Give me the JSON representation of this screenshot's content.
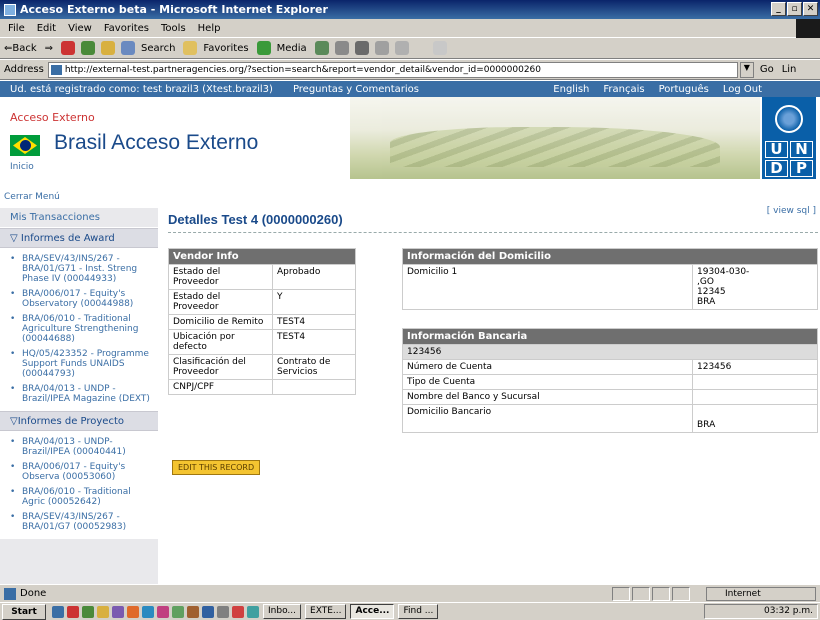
{
  "window": {
    "title": "Acceso Externo beta - Microsoft Internet Explorer"
  },
  "menu": [
    "File",
    "Edit",
    "View",
    "Favorites",
    "Tools",
    "Help"
  ],
  "toolbar": {
    "back": "⇐Back",
    "search": "Search",
    "favorites": "Favorites",
    "media": "Media"
  },
  "address": {
    "label": "Address",
    "url": "http://external-test.partneragencies.org/?section=search&report=vendor_detail&vendor_id=0000000260",
    "go": "Go",
    "links": "Lin"
  },
  "topnav": {
    "user": "Ud. está registrado como: test brazil3 (Xtest.brazil3)",
    "preguntas": "Preguntas y Comentarios",
    "langs": [
      "English",
      "Français",
      "Português",
      "Log Out"
    ]
  },
  "banner": {
    "acceso": "Acceso Externo",
    "title": "Brasil Acceso Externo",
    "inicio": "Inicio",
    "undp": [
      "U",
      "N",
      "D",
      "P"
    ]
  },
  "sidebar": {
    "cerrar": "Cerrar Menú",
    "transacciones": "Mis Transacciones",
    "award_title": "Informes de Award",
    "award_items": [
      "BRA/SEV/43/INS/267 - BRA/01/G71 - Inst. Streng Phase IV (00044933)",
      "BRA/006/017 - Equity's Observatory (00044988)",
      "BRA/06/010 - Traditional Agriculture Strengthening (00044688)",
      "HQ/05/423352 - Programme Support Funds UNAIDS (00044793)",
      "BRA/04/013 - UNDP - Brazil/IPEA Magazine (DEXT)"
    ],
    "proyecto_title": "Informes de Proyecto",
    "proyecto_items": [
      "BRA/04/013 - UNDP- Brazil/IPEA (00040441)",
      "BRA/006/017 - Equity's Observa (00053060)",
      "BRA/06/010 - Traditional Agric (00052642)",
      "BRA/SEV/43/INS/267 - BRA/01/G7 (00052983)"
    ]
  },
  "main": {
    "view_sql": "[ view sql ]",
    "title": "Detalles Test 4 (0000000260)",
    "vendor": {
      "header": "Vendor Info",
      "rows": [
        [
          "Estado del Proveedor",
          "Aprobado"
        ],
        [
          "Estado del Proveedor",
          "Y"
        ],
        [
          "Domicilio de Remito",
          "TEST4"
        ],
        [
          "Ubicación por defecto",
          "TEST4"
        ],
        [
          "Clasificación del Proveedor",
          "Contrato de Servicios"
        ],
        [
          "CNPJ/CPF",
          ""
        ]
      ]
    },
    "domicilio": {
      "header": "Información del Domicilio",
      "label": "Domicilio 1",
      "lines": [
        "19304-030-",
        ",GO",
        "12345",
        "BRA"
      ]
    },
    "bancaria": {
      "header": "Información Bancaria",
      "account": "123456",
      "rows": [
        [
          "Número de Cuenta",
          "123456"
        ],
        [
          "Tipo de Cuenta",
          ""
        ],
        [
          "Nombre del Banco y Sucursal",
          ""
        ],
        [
          "Domicilio Bancario",
          "BRA"
        ]
      ]
    },
    "edit": "EDIT THIS RECORD"
  },
  "status": {
    "done": "Done",
    "zone": "Internet"
  },
  "taskbar": {
    "start": "Start",
    "tasks": [
      "Inbo...",
      "EXTE...",
      "Acce...",
      "Find ..."
    ],
    "time": "03:32 p.m."
  }
}
